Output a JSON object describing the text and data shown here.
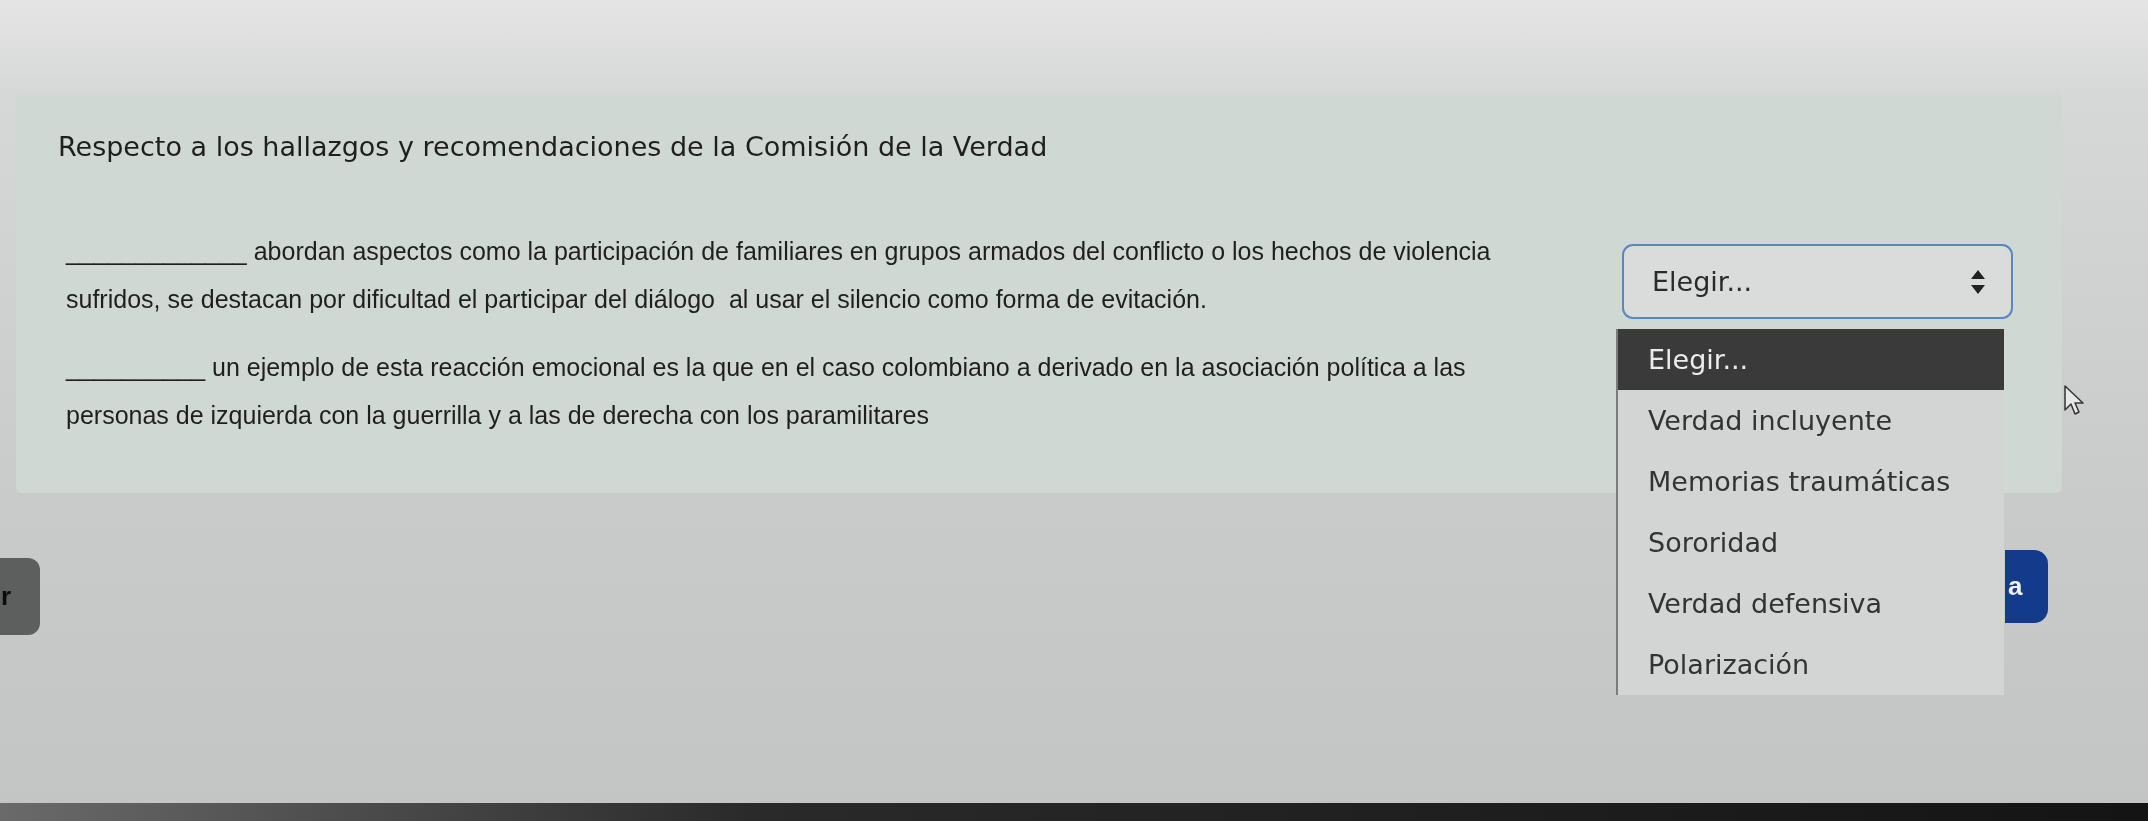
{
  "question_title": "Respecto a los hallazgos y recomendaciones de la Comisión de la Verdad",
  "questions": [
    {
      "lines": [
        "_____________ abordan aspectos como la participación de familiares en grupos armados del conflicto o los hechos de violencia",
        "sufridos, se destacan por dificultad el participar del diálogo  al usar el silencio como forma de evitación."
      ],
      "select": {
        "value": "Elegir...",
        "open": true,
        "options": [
          {
            "label": "Elegir...",
            "selected": true
          },
          {
            "label": "Verdad incluyente",
            "selected": false
          },
          {
            "label": "Memorias traumáticas",
            "selected": false
          },
          {
            "label": "Sororidad",
            "selected": false
          },
          {
            "label": "Verdad defensiva",
            "selected": false
          },
          {
            "label": "Polarización",
            "selected": false
          }
        ]
      }
    },
    {
      "lines": [
        "__________ un ejemplo de esta reacción emocional es la que en el caso colombiano a derivado en la asociación política a las",
        "personas de izquierda con la guerrilla y a las de derecha con los paramilitares"
      ]
    }
  ],
  "nav_buttons": [
    {
      "label": "r",
      "kind": "secondary"
    },
    {
      "label": "a",
      "kind": "primary"
    }
  ]
}
